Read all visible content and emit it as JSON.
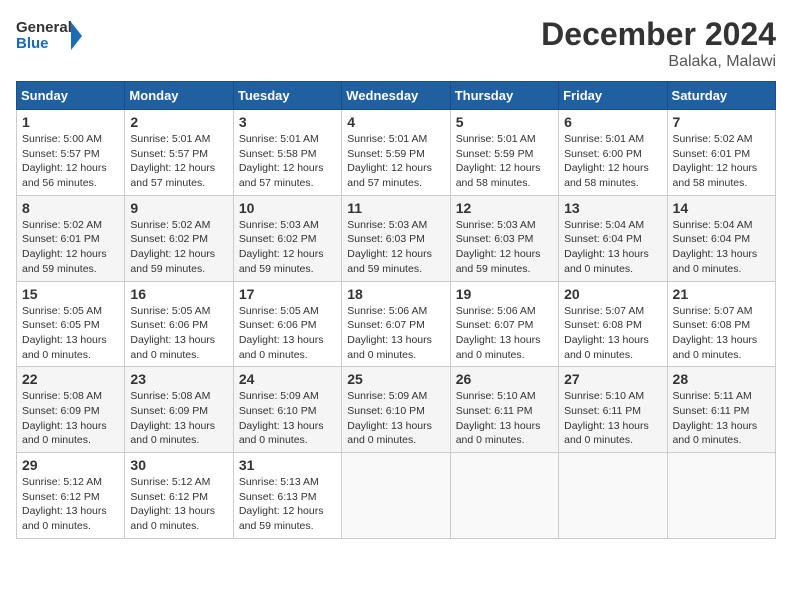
{
  "logo": {
    "line1": "General",
    "line2": "Blue"
  },
  "title": "December 2024",
  "location": "Balaka, Malawi",
  "days_of_week": [
    "Sunday",
    "Monday",
    "Tuesday",
    "Wednesday",
    "Thursday",
    "Friday",
    "Saturday"
  ],
  "weeks": [
    [
      {
        "day": "1",
        "sunrise": "Sunrise: 5:00 AM",
        "sunset": "Sunset: 5:57 PM",
        "daylight": "Daylight: 12 hours and 56 minutes."
      },
      {
        "day": "2",
        "sunrise": "Sunrise: 5:01 AM",
        "sunset": "Sunset: 5:57 PM",
        "daylight": "Daylight: 12 hours and 57 minutes."
      },
      {
        "day": "3",
        "sunrise": "Sunrise: 5:01 AM",
        "sunset": "Sunset: 5:58 PM",
        "daylight": "Daylight: 12 hours and 57 minutes."
      },
      {
        "day": "4",
        "sunrise": "Sunrise: 5:01 AM",
        "sunset": "Sunset: 5:59 PM",
        "daylight": "Daylight: 12 hours and 57 minutes."
      },
      {
        "day": "5",
        "sunrise": "Sunrise: 5:01 AM",
        "sunset": "Sunset: 5:59 PM",
        "daylight": "Daylight: 12 hours and 58 minutes."
      },
      {
        "day": "6",
        "sunrise": "Sunrise: 5:01 AM",
        "sunset": "Sunset: 6:00 PM",
        "daylight": "Daylight: 12 hours and 58 minutes."
      },
      {
        "day": "7",
        "sunrise": "Sunrise: 5:02 AM",
        "sunset": "Sunset: 6:01 PM",
        "daylight": "Daylight: 12 hours and 58 minutes."
      }
    ],
    [
      {
        "day": "8",
        "sunrise": "Sunrise: 5:02 AM",
        "sunset": "Sunset: 6:01 PM",
        "daylight": "Daylight: 12 hours and 59 minutes."
      },
      {
        "day": "9",
        "sunrise": "Sunrise: 5:02 AM",
        "sunset": "Sunset: 6:02 PM",
        "daylight": "Daylight: 12 hours and 59 minutes."
      },
      {
        "day": "10",
        "sunrise": "Sunrise: 5:03 AM",
        "sunset": "Sunset: 6:02 PM",
        "daylight": "Daylight: 12 hours and 59 minutes."
      },
      {
        "day": "11",
        "sunrise": "Sunrise: 5:03 AM",
        "sunset": "Sunset: 6:03 PM",
        "daylight": "Daylight: 12 hours and 59 minutes."
      },
      {
        "day": "12",
        "sunrise": "Sunrise: 5:03 AM",
        "sunset": "Sunset: 6:03 PM",
        "daylight": "Daylight: 12 hours and 59 minutes."
      },
      {
        "day": "13",
        "sunrise": "Sunrise: 5:04 AM",
        "sunset": "Sunset: 6:04 PM",
        "daylight": "Daylight: 13 hours and 0 minutes."
      },
      {
        "day": "14",
        "sunrise": "Sunrise: 5:04 AM",
        "sunset": "Sunset: 6:04 PM",
        "daylight": "Daylight: 13 hours and 0 minutes."
      }
    ],
    [
      {
        "day": "15",
        "sunrise": "Sunrise: 5:05 AM",
        "sunset": "Sunset: 6:05 PM",
        "daylight": "Daylight: 13 hours and 0 minutes."
      },
      {
        "day": "16",
        "sunrise": "Sunrise: 5:05 AM",
        "sunset": "Sunset: 6:06 PM",
        "daylight": "Daylight: 13 hours and 0 minutes."
      },
      {
        "day": "17",
        "sunrise": "Sunrise: 5:05 AM",
        "sunset": "Sunset: 6:06 PM",
        "daylight": "Daylight: 13 hours and 0 minutes."
      },
      {
        "day": "18",
        "sunrise": "Sunrise: 5:06 AM",
        "sunset": "Sunset: 6:07 PM",
        "daylight": "Daylight: 13 hours and 0 minutes."
      },
      {
        "day": "19",
        "sunrise": "Sunrise: 5:06 AM",
        "sunset": "Sunset: 6:07 PM",
        "daylight": "Daylight: 13 hours and 0 minutes."
      },
      {
        "day": "20",
        "sunrise": "Sunrise: 5:07 AM",
        "sunset": "Sunset: 6:08 PM",
        "daylight": "Daylight: 13 hours and 0 minutes."
      },
      {
        "day": "21",
        "sunrise": "Sunrise: 5:07 AM",
        "sunset": "Sunset: 6:08 PM",
        "daylight": "Daylight: 13 hours and 0 minutes."
      }
    ],
    [
      {
        "day": "22",
        "sunrise": "Sunrise: 5:08 AM",
        "sunset": "Sunset: 6:09 PM",
        "daylight": "Daylight: 13 hours and 0 minutes."
      },
      {
        "day": "23",
        "sunrise": "Sunrise: 5:08 AM",
        "sunset": "Sunset: 6:09 PM",
        "daylight": "Daylight: 13 hours and 0 minutes."
      },
      {
        "day": "24",
        "sunrise": "Sunrise: 5:09 AM",
        "sunset": "Sunset: 6:10 PM",
        "daylight": "Daylight: 13 hours and 0 minutes."
      },
      {
        "day": "25",
        "sunrise": "Sunrise: 5:09 AM",
        "sunset": "Sunset: 6:10 PM",
        "daylight": "Daylight: 13 hours and 0 minutes."
      },
      {
        "day": "26",
        "sunrise": "Sunrise: 5:10 AM",
        "sunset": "Sunset: 6:11 PM",
        "daylight": "Daylight: 13 hours and 0 minutes."
      },
      {
        "day": "27",
        "sunrise": "Sunrise: 5:10 AM",
        "sunset": "Sunset: 6:11 PM",
        "daylight": "Daylight: 13 hours and 0 minutes."
      },
      {
        "day": "28",
        "sunrise": "Sunrise: 5:11 AM",
        "sunset": "Sunset: 6:11 PM",
        "daylight": "Daylight: 13 hours and 0 minutes."
      }
    ],
    [
      {
        "day": "29",
        "sunrise": "Sunrise: 5:12 AM",
        "sunset": "Sunset: 6:12 PM",
        "daylight": "Daylight: 13 hours and 0 minutes."
      },
      {
        "day": "30",
        "sunrise": "Sunrise: 5:12 AM",
        "sunset": "Sunset: 6:12 PM",
        "daylight": "Daylight: 13 hours and 0 minutes."
      },
      {
        "day": "31",
        "sunrise": "Sunrise: 5:13 AM",
        "sunset": "Sunset: 6:13 PM",
        "daylight": "Daylight: 12 hours and 59 minutes."
      },
      null,
      null,
      null,
      null
    ]
  ]
}
